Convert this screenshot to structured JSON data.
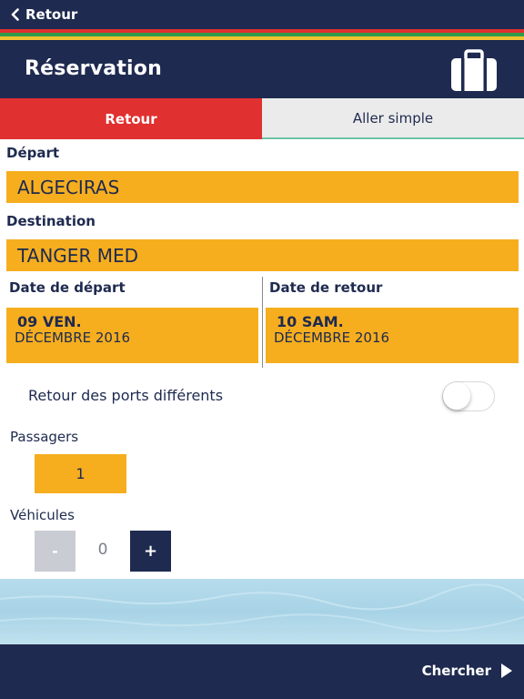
{
  "nav": {
    "back_label": "Retour"
  },
  "colors": {
    "navy": "#1e2a4f",
    "accent_yellow": "#f6ae1f",
    "active_red": "#e03030",
    "stripes": [
      "#e03030",
      "#2f9b4a",
      "#f2c230",
      "#1e2a4f"
    ]
  },
  "header": {
    "title": "Réservation",
    "icon": "suitcase-icon"
  },
  "tabs": [
    {
      "label": "Retour",
      "active": true
    },
    {
      "label": "Aller simple",
      "active": false
    }
  ],
  "form": {
    "departure": {
      "label": "Départ",
      "value": "ALGECIRAS"
    },
    "destination": {
      "label": "Destination",
      "value": "TANGER MED"
    },
    "departure_date": {
      "label": "Date de départ",
      "day": "09 VEN.",
      "month_year": "DÉCEMBRE 2016"
    },
    "return_date": {
      "label": "Date de retour",
      "day": "10 SAM.",
      "month_year": "DÉCEMBRE 2016"
    },
    "different_ports": {
      "label": "Retour des ports différents",
      "enabled": false
    },
    "passengers": {
      "label": "Passagers",
      "value": "1"
    },
    "vehicles": {
      "label": "Véhicules",
      "minus": "-",
      "value": "0",
      "plus": "+"
    }
  },
  "footer": {
    "search_label": "Chercher",
    "icon": "play-arrow-icon"
  }
}
